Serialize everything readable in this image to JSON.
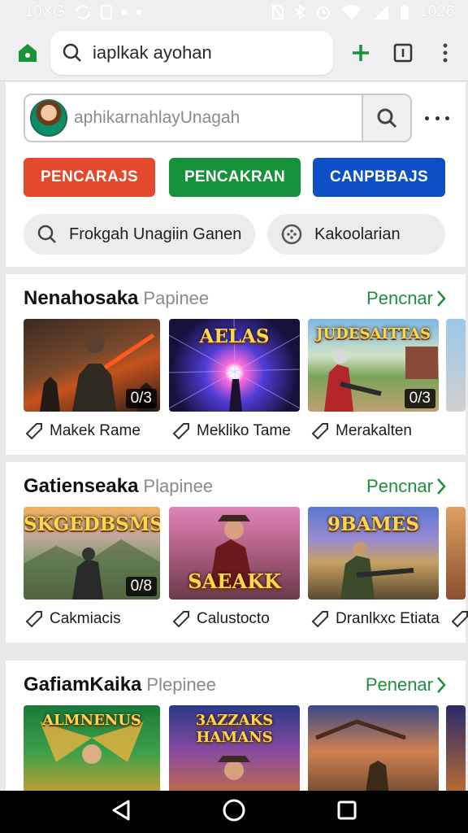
{
  "status_bar": {
    "left_text": "10XG",
    "time": "1026"
  },
  "browser": {
    "url": "iaplkak ayohan"
  },
  "search": {
    "placeholder": "aphikarnahlayUnagah"
  },
  "category_buttons": [
    {
      "label": "PENCARAJS",
      "color": "#e4492c"
    },
    {
      "label": "PENCAKRAN",
      "color": "#16923a"
    },
    {
      "label": "CANPBBAJS",
      "color": "#0d4fc6"
    }
  ],
  "chips": [
    {
      "label": "Frokgah Unagiin Ganen",
      "icon": "search-icon"
    },
    {
      "label": "Kakoolarian",
      "icon": "compass-icon"
    }
  ],
  "sections": [
    {
      "title": "Nenahosaka",
      "subtitle": "Papinee",
      "link": "Pencnar",
      "items": [
        {
          "name": "Makek Rame",
          "thumb_title": "",
          "badge": "0/3"
        },
        {
          "name": "Mekliko Tame",
          "thumb_title": "AELAS",
          "badge": ""
        },
        {
          "name": "Merakalten",
          "thumb_title": "JUDESAITTAS",
          "badge": "0/3"
        }
      ]
    },
    {
      "title": "Gatienseaka",
      "subtitle": "Plapinee",
      "link": "Pencnar",
      "items": [
        {
          "name": "Cakmiacis",
          "thumb_title": "SKGEDBSMS",
          "badge": "0/8"
        },
        {
          "name": "Calustocto",
          "thumb_title": "SAEAKK",
          "badge": ""
        },
        {
          "name": "Dranlkxc Etiata",
          "thumb_title": "9BAMES",
          "badge": ""
        }
      ]
    },
    {
      "title": "GafiamKaika",
      "subtitle": "Plepinee",
      "link": "Penenar",
      "items": [
        {
          "name": "",
          "thumb_title": "ALMNENUS",
          "badge": ""
        },
        {
          "name": "",
          "thumb_title": "3AZZAKS HAMANS",
          "badge": ""
        },
        {
          "name": "",
          "thumb_title": "",
          "badge": ""
        }
      ]
    }
  ],
  "colors": {
    "accent_green": "#1f8f3c",
    "chrome_bg": "#efeff1"
  }
}
